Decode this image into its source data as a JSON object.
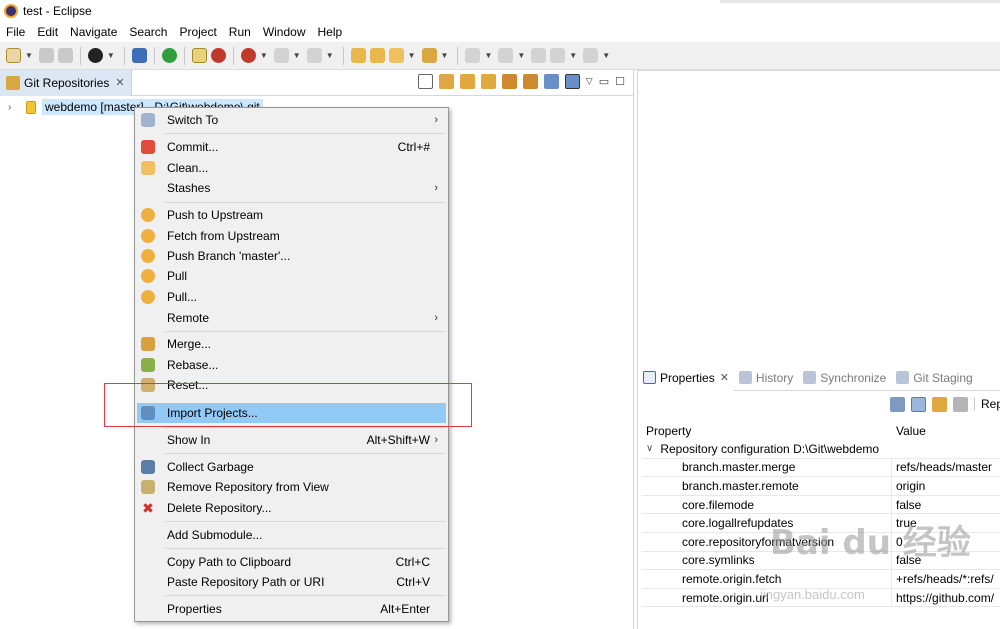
{
  "window": {
    "title": "test - Eclipse"
  },
  "menubar": [
    "File",
    "Edit",
    "Navigate",
    "Search",
    "Project",
    "Run",
    "Window",
    "Help"
  ],
  "git_view": {
    "tab_label": "Git Repositories",
    "repo_label": "webdemo [master] - D:\\Git\\webdemo\\.git"
  },
  "context_menu": {
    "items": [
      {
        "label": "Switch To",
        "accel": "",
        "submenu": true
      },
      {
        "label": "Commit...",
        "accel": "Ctrl+#",
        "submenu": false
      },
      {
        "label": "Clean...",
        "accel": "",
        "submenu": false
      },
      {
        "label": "Stashes",
        "accel": "",
        "submenu": true
      },
      {
        "label": "Push to Upstream",
        "accel": "",
        "submenu": false
      },
      {
        "label": "Fetch from Upstream",
        "accel": "",
        "submenu": false
      },
      {
        "label": "Push Branch 'master'...",
        "accel": "",
        "submenu": false
      },
      {
        "label": "Pull",
        "accel": "",
        "submenu": false
      },
      {
        "label": "Pull...",
        "accel": "",
        "submenu": false
      },
      {
        "label": "Remote",
        "accel": "",
        "submenu": true
      },
      {
        "label": "Merge...",
        "accel": "",
        "submenu": false
      },
      {
        "label": "Rebase...",
        "accel": "",
        "submenu": false
      },
      {
        "label": "Reset...",
        "accel": "",
        "submenu": false
      },
      {
        "label": "Import Projects...",
        "accel": "",
        "submenu": false
      },
      {
        "label": "Show In",
        "accel": "Alt+Shift+W",
        "submenu": true
      },
      {
        "label": "Collect Garbage",
        "accel": "",
        "submenu": false
      },
      {
        "label": "Remove Repository from View",
        "accel": "",
        "submenu": false
      },
      {
        "label": "Delete Repository...",
        "accel": "",
        "submenu": false
      },
      {
        "label": "Add Submodule...",
        "accel": "",
        "submenu": false
      },
      {
        "label": "Copy Path to Clipboard",
        "accel": "Ctrl+C",
        "submenu": false
      },
      {
        "label": "Paste Repository Path or URI",
        "accel": "Ctrl+V",
        "submenu": false
      },
      {
        "label": "Properties",
        "accel": "Alt+Enter",
        "submenu": false
      }
    ],
    "highlighted": "Import Projects..."
  },
  "properties_view": {
    "tabs": [
      "Properties",
      "History",
      "Synchronize",
      "Git Staging"
    ],
    "toolbar_label": "Rep",
    "columns": {
      "property": "Property",
      "value": "Value"
    },
    "group": "Repository configuration D:\\Git\\webdemo",
    "rows": [
      {
        "key": "branch.master.merge",
        "value": "refs/heads/master"
      },
      {
        "key": "branch.master.remote",
        "value": "origin"
      },
      {
        "key": "core.filemode",
        "value": "false"
      },
      {
        "key": "core.logallrefupdates",
        "value": "true"
      },
      {
        "key": "core.repositoryformatversion",
        "value": "0"
      },
      {
        "key": "core.symlinks",
        "value": "false"
      },
      {
        "key": "remote.origin.fetch",
        "value": "+refs/heads/*:refs/"
      },
      {
        "key": "remote.origin.url",
        "value": "https://github.com/"
      }
    ]
  },
  "watermark": {
    "text": "Bai du 经验",
    "sub": "jingyan.baidu.com"
  },
  "colors": {
    "highlight": "#91c9f7",
    "selection": "#cce8ff",
    "annotation": "#e23a3a",
    "tab_active": "#dbe7f5"
  }
}
